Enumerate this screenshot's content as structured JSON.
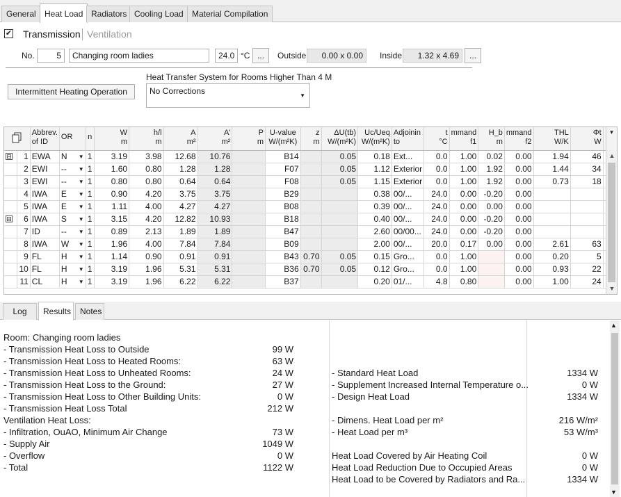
{
  "tabs": [
    "General",
    "Heat Load",
    "Radiators",
    "Cooling Load",
    "Material Compilation"
  ],
  "mode": {
    "transmission": "Transmission",
    "ventilation": "Ventilation",
    "checked": "✔"
  },
  "room": {
    "no_label": "No.",
    "no": "5",
    "name": "Changing room ladies",
    "temp": "24.0",
    "temp_unit": "°C",
    "ellipsis": "...",
    "outside_label": "Outside",
    "outside": "0.00 x 0.00",
    "inside_label": "Inside",
    "inside": "1.32 x 4.69"
  },
  "intermittent_button": "Intermittent Heating Operation",
  "heat_transfer": {
    "label": "Heat Transfer System for Rooms Higher Than 4 M",
    "value": "No Corrections"
  },
  "grid": {
    "headers": [
      {
        "l1": "",
        "l2": ""
      },
      {
        "l1": "Abbrev.",
        "l2": "of ID"
      },
      {
        "l1": "OR",
        "l2": ""
      },
      {
        "l1": "n",
        "l2": ""
      },
      {
        "l1": "W",
        "l2": "m"
      },
      {
        "l1": "h/l",
        "l2": "m"
      },
      {
        "l1": "A",
        "l2": "m²"
      },
      {
        "l1": "A'",
        "l2": "m²"
      },
      {
        "l1": "P",
        "l2": "m"
      },
      {
        "l1": "U-value",
        "l2": "W/(m²K)"
      },
      {
        "l1": "z",
        "l2": "m"
      },
      {
        "l1": "ΔU(tb)",
        "l2": "W/(m²K)"
      },
      {
        "l1": "Uc/Ueq",
        "l2": "W/(m²K)"
      },
      {
        "l1": "Adjoinin",
        "l2": "to"
      },
      {
        "l1": "t",
        "l2": "°C"
      },
      {
        "l1": "mmand",
        "l2": "f1"
      },
      {
        "l1": "H_b",
        "l2": "m"
      },
      {
        "l1": "mmand",
        "l2": "f2"
      },
      {
        "l1": "THL",
        "l2": "W/K"
      },
      {
        "l1": "Φt",
        "l2": "W"
      },
      {
        "l1": "!",
        "l2": ""
      }
    ],
    "rows": [
      {
        "n": "1",
        "id": "EWA",
        "or": "N",
        "cnt": "1",
        "w": "3.19",
        "hl": "3.98",
        "a": "12.68",
        "a2": "10.76",
        "p": "",
        "u": "B14",
        "z": "",
        "dutb": "0.05",
        "uc": "0.18",
        "adj": "Ext...",
        "t": "0.0",
        "f1": "1.00",
        "hb": "0.02",
        "f2": "0.00",
        "thl": "1.94",
        "phi": "46",
        "tree": "⊟"
      },
      {
        "n": "2",
        "id": "EWI",
        "or": "--",
        "cnt": "1",
        "w": "1.60",
        "hl": "0.80",
        "a": "1.28",
        "a2": "1.28",
        "p": "",
        "u": "F07",
        "z": "",
        "dutb": "0.05",
        "uc": "1.12",
        "adj": "Exterior",
        "t": "0.0",
        "f1": "1.00",
        "hb": "1.92",
        "f2": "0.00",
        "thl": "1.44",
        "phi": "34",
        "tree": ""
      },
      {
        "n": "3",
        "id": "EWI",
        "or": "--",
        "cnt": "1",
        "w": "0.80",
        "hl": "0.80",
        "a": "0.64",
        "a2": "0.64",
        "p": "",
        "u": "F08",
        "z": "",
        "dutb": "0.05",
        "uc": "1.15",
        "adj": "Exterior",
        "t": "0.0",
        "f1": "1.00",
        "hb": "1.92",
        "f2": "0.00",
        "thl": "0.73",
        "phi": "18",
        "tree": ""
      },
      {
        "n": "4",
        "id": "IWA",
        "or": "E",
        "cnt": "1",
        "w": "0.90",
        "hl": "4.20",
        "a": "3.75",
        "a2": "3.75",
        "p": "",
        "u": "B29",
        "z": "",
        "dutb": "",
        "uc": "0.38",
        "adj": "00/...",
        "t": "24.0",
        "f1": "0.00",
        "hb": "-0.20",
        "f2": "0.00",
        "thl": "",
        "phi": "",
        "tree": ""
      },
      {
        "n": "5",
        "id": "IWA",
        "or": "E",
        "cnt": "1",
        "w": "1.11",
        "hl": "4.00",
        "a": "4.27",
        "a2": "4.27",
        "p": "",
        "u": "B08",
        "z": "",
        "dutb": "",
        "uc": "0.39",
        "adj": "00/...",
        "t": "24.0",
        "f1": "0.00",
        "hb": "0.00",
        "f2": "0.00",
        "thl": "",
        "phi": "",
        "tree": ""
      },
      {
        "n": "6",
        "id": "IWA",
        "or": "S",
        "cnt": "1",
        "w": "3.15",
        "hl": "4.20",
        "a": "12.82",
        "a2": "10.93",
        "p": "",
        "u": "B18",
        "z": "",
        "dutb": "",
        "uc": "0.40",
        "adj": "00/...",
        "t": "24.0",
        "f1": "0.00",
        "hb": "-0.20",
        "f2": "0.00",
        "thl": "",
        "phi": "",
        "tree": "⊟"
      },
      {
        "n": "7",
        "id": "ID",
        "or": "--",
        "cnt": "1",
        "w": "0.89",
        "hl": "2.13",
        "a": "1.89",
        "a2": "1.89",
        "p": "",
        "u": "B47",
        "z": "",
        "dutb": "",
        "uc": "2.60",
        "adj": "00/00...",
        "t": "24.0",
        "f1": "0.00",
        "hb": "-0.20",
        "f2": "0.00",
        "thl": "",
        "phi": "",
        "tree": ""
      },
      {
        "n": "8",
        "id": "IWA",
        "or": "W",
        "cnt": "1",
        "w": "1.96",
        "hl": "4.00",
        "a": "7.84",
        "a2": "7.84",
        "p": "",
        "u": "B09",
        "z": "",
        "dutb": "",
        "uc": "2.00",
        "adj": "00/...",
        "t": "20.0",
        "f1": "0.17",
        "hb": "0.00",
        "f2": "0.00",
        "thl": "2.61",
        "phi": "63",
        "tree": ""
      },
      {
        "n": "9",
        "id": "FL",
        "or": "H",
        "cnt": "1",
        "w": "1.14",
        "hl": "0.90",
        "a": "0.91",
        "a2": "0.91",
        "p": "",
        "u": "B43",
        "z": "0.70",
        "dutb": "0.05",
        "uc": "0.15",
        "adj": "Gro...",
        "t": "0.0",
        "f1": "1.00",
        "hb": "",
        "f2": "0.00",
        "thl": "0.20",
        "phi": "5",
        "tree": ""
      },
      {
        "n": "10",
        "id": "FL",
        "or": "H",
        "cnt": "1",
        "w": "3.19",
        "hl": "1.96",
        "a": "5.31",
        "a2": "5.31",
        "p": "",
        "u": "B36",
        "z": "0.70",
        "dutb": "0.05",
        "uc": "0.12",
        "adj": "Gro...",
        "t": "0.0",
        "f1": "1.00",
        "hb": "",
        "f2": "0.00",
        "thl": "0.93",
        "phi": "22",
        "tree": ""
      },
      {
        "n": "11",
        "id": "CL",
        "or": "H",
        "cnt": "1",
        "w": "3.19",
        "hl": "1.96",
        "a": "6.22",
        "a2": "6.22",
        "p": "",
        "u": "B37",
        "z": "",
        "dutb": "",
        "uc": "0.20",
        "adj": "01/...",
        "t": "4.8",
        "f1": "0.80",
        "hb": "",
        "f2": "0.00",
        "thl": "1.00",
        "phi": "24",
        "tree": ""
      }
    ]
  },
  "bottom_tabs": [
    "Log",
    "Results",
    "Notes"
  ],
  "results": {
    "left": [
      {
        "label": "Room: Changing room ladies",
        "value": ""
      },
      {
        "label": "- Transmission Heat Loss to Outside",
        "value": "99 W"
      },
      {
        "label": "- Transmission Heat Loss to Heated Rooms:",
        "value": "63 W"
      },
      {
        "label": "- Transmission Heat Loss to Unheated Rooms:",
        "value": "24 W"
      },
      {
        "label": "- Transmission Heat Loss to the Ground:",
        "value": "27 W"
      },
      {
        "label": "- Transmission Heat Loss to Other Building Units:",
        "value": "0 W"
      },
      {
        "label": "- Transmission Heat Loss Total",
        "value": "212 W"
      },
      {
        "label": "Ventilation Heat Loss:",
        "value": ""
      },
      {
        "label": "- Infiltration, OuAO, Minimum Air Change",
        "value": "73 W"
      },
      {
        "label": "- Supply Air",
        "value": "1049 W"
      },
      {
        "label": "- Overflow",
        "value": "0 W"
      },
      {
        "label": "- Total",
        "value": "1122 W"
      }
    ],
    "right": [
      {
        "label": "- Standard Heat Load",
        "value": "1334 W"
      },
      {
        "label": "- Supplement Increased Internal Temperature o...",
        "value": "0 W"
      },
      {
        "label": "- Design Heat Load",
        "value": "1334 W"
      },
      {
        "label": "",
        "value": ""
      },
      {
        "label": "- Dimens. Heat Load per m²",
        "value": "216 W/m²"
      },
      {
        "label": "- Heat Load per m³",
        "value": "53 W/m³"
      },
      {
        "label": "",
        "value": ""
      },
      {
        "label": "Heat Load Covered by Air Heating Coil",
        "value": "0 W"
      },
      {
        "label": "Heat Load Reduction Due to Occupied Areas",
        "value": "0 W"
      },
      {
        "label": "Heat Load to be Covered by Radiators and Ra...",
        "value": "1334 W"
      }
    ]
  },
  "icons": {
    "copy": "copy-icon",
    "dropdown": "▼",
    "scroll_up": "▲",
    "scroll_down": "▼"
  }
}
